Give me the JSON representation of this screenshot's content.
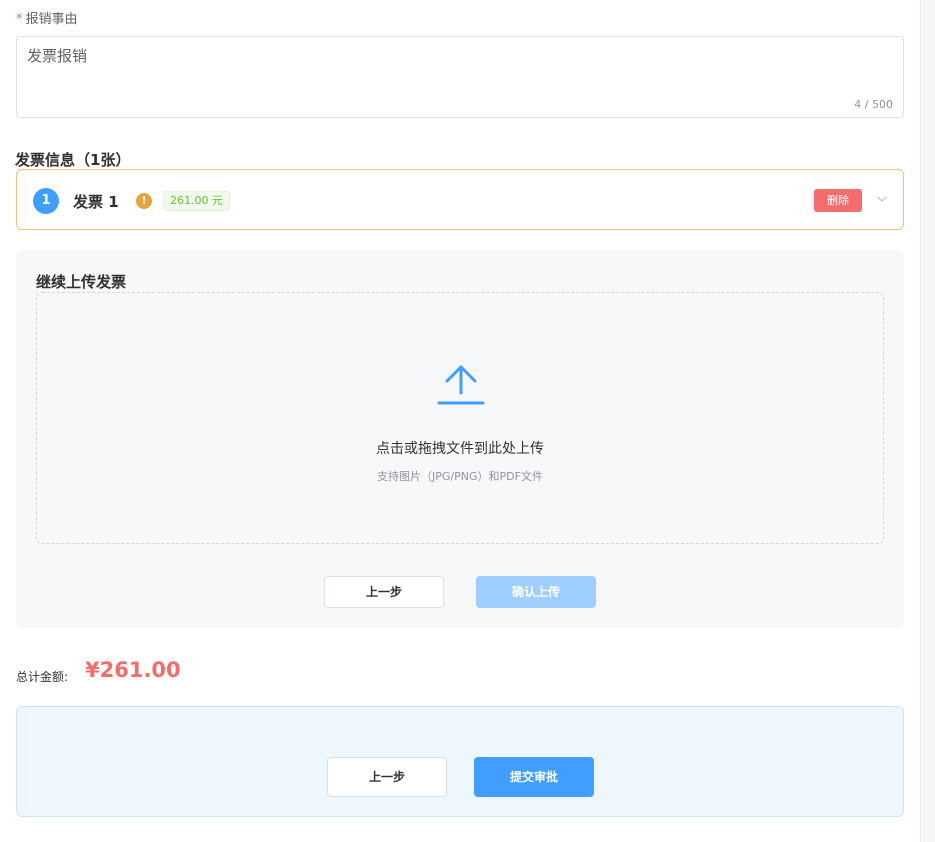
{
  "reason_field": {
    "required_mark": "*",
    "label": "报销事由",
    "value": "发票报销",
    "char_count": "4 / 500"
  },
  "invoice_section": {
    "title": "发票信息（1张）",
    "items": [
      {
        "index": "1",
        "name": "发票 1",
        "warning_icon": "exclamation-icon",
        "amount": "261.00 元",
        "delete_label": "删除",
        "expand_icon": "chevron-down-icon"
      }
    ]
  },
  "upload": {
    "title": "继续上传发票",
    "icon": "upload-icon",
    "main_text": "点击或拖拽文件到此处上传",
    "hint_text": "支持图片（JPG/PNG）和PDF文件",
    "prev_label": "上一步",
    "confirm_label": "确认上传"
  },
  "summary": {
    "total_label": "总计金额:",
    "total_value": "¥261.00"
  },
  "actions": {
    "prev_label": "上一步",
    "submit_label": "提交审批"
  },
  "colors": {
    "primary": "#409eff",
    "danger": "#f56c6c",
    "warning": "#e6a23c",
    "success": "#67c23a"
  }
}
